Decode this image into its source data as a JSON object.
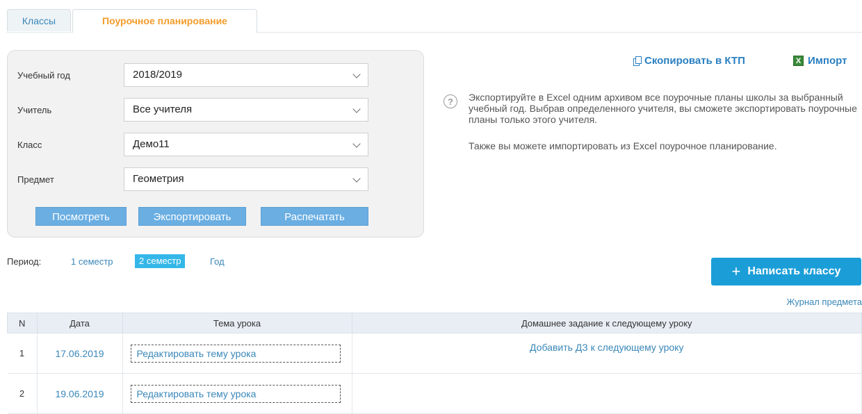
{
  "tabs": [
    {
      "label": "Классы"
    },
    {
      "label": "Поурочное планирование"
    }
  ],
  "filters": {
    "year": {
      "label": "Учебный год",
      "value": "2018/2019"
    },
    "teacher": {
      "label": "Учитель",
      "value": "Все учителя"
    },
    "class": {
      "label": "Класс",
      "value": "Демо11"
    },
    "subject": {
      "label": "Предмет",
      "value": "Геометрия"
    }
  },
  "buttons": {
    "view": "Посмотреть",
    "export": "Экспортировать",
    "print": "Распечатать"
  },
  "actions": {
    "copy": "Скопировать в КТП",
    "import": "Импорт",
    "excel_icon_glyph": "X"
  },
  "help": {
    "glyph": "?",
    "text1": "Экспортируйте в Excel одним архивом все поурочные планы школы за выбранный учебный год. Выбрав определенного учителя, вы сможете экспортировать поурочные планы только этого учителя.",
    "text2": "Также вы можете импортировать из Excel поурочное планирование."
  },
  "period": {
    "label": "Период:",
    "options": [
      "1 семестр",
      "2 семестр",
      "Год"
    ],
    "active": "2 семестр"
  },
  "write_class": {
    "plus": "+",
    "label": "Написать классу"
  },
  "journal_link": "Журнал предмета",
  "table": {
    "headers": [
      "N",
      "Дата",
      "Тема урока",
      "Домашнее задание к следующему уроку"
    ],
    "rows": [
      {
        "n": "1",
        "date": "17.06.2019",
        "topic": "Редактировать тему урока",
        "hw": "Добавить ДЗ к следующему уроку"
      },
      {
        "n": "2",
        "date": "19.06.2019",
        "topic": "Редактировать тему урока",
        "hw": ""
      }
    ]
  }
}
